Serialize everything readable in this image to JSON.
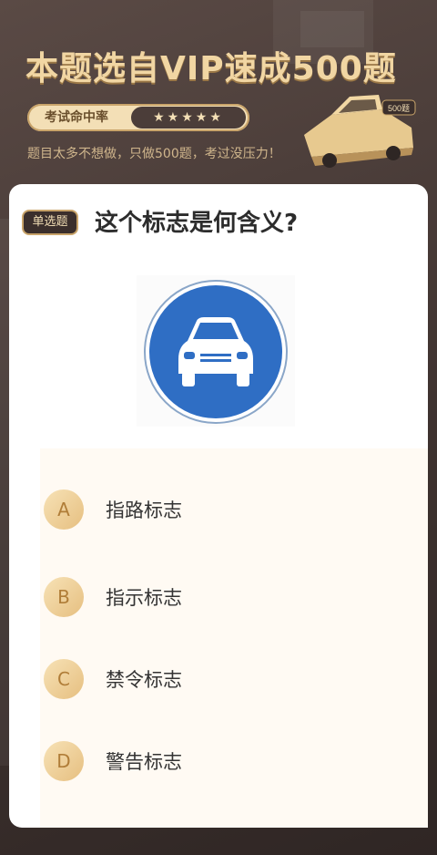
{
  "header": {
    "vip_title": "本题选自VIP速成500题",
    "rate_label": "考试命中率",
    "rate_stars": "★★★★★",
    "subtitle": "题目太多不想做，只做500题，考过没压力！",
    "car_badge": "500题"
  },
  "question": {
    "type_badge": "单选题",
    "text": "这个标志是何含义?",
    "sign_icon": "motor-vehicle-lane-sign-icon"
  },
  "options": [
    {
      "letter": "A",
      "text": "指路标志"
    },
    {
      "letter": "B",
      "text": "指示标志"
    },
    {
      "letter": "C",
      "text": "禁令标志"
    },
    {
      "letter": "D",
      "text": "警告标志"
    }
  ],
  "colors": {
    "gold": "#f1d6a3",
    "dark_bg": "#3f3330",
    "sign_blue": "#2f6ec4"
  }
}
